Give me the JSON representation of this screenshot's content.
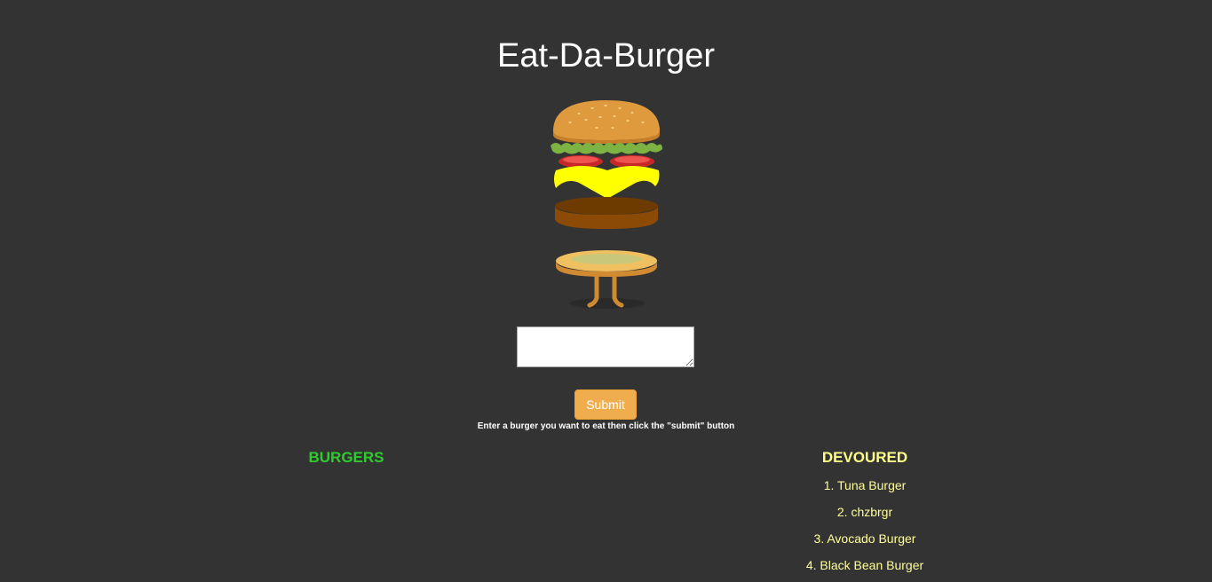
{
  "header": {
    "title": "Eat-Da-Burger"
  },
  "form": {
    "input_value": "",
    "input_placeholder": "",
    "submit_label": "Submit",
    "instructions": "Enter a burger you want to eat then click the \"submit\" button"
  },
  "burgers": {
    "heading": "BURGERS",
    "items": []
  },
  "devoured": {
    "heading": "DEVOURED",
    "items": [
      "1. Tuna Burger",
      "2. chzbrgr",
      "3. Avocado Burger",
      "4. Black Bean Burger"
    ]
  },
  "colors": {
    "background": "#333333",
    "burgers_heading": "#2ecc2e",
    "devoured_heading": "#ffff88",
    "submit_button": "#f0ad4e"
  },
  "icons": {
    "hero": "burger-mascot-icon"
  }
}
